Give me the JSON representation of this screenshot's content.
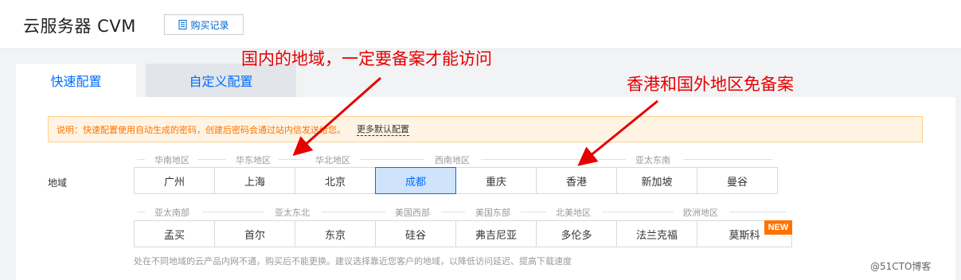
{
  "header": {
    "title": "云服务器 CVM",
    "history_button": "购买记录"
  },
  "tabs": [
    {
      "label": "快速配置",
      "active": true
    },
    {
      "label": "自定义配置",
      "active": false
    }
  ],
  "notice": {
    "text": "说明：快速配置使用自动生成的密码，创建后密码会通过站内信发送给您。",
    "more_link": "更多默认配置"
  },
  "region": {
    "label": "地域",
    "row1_groups": [
      "华南地区",
      "华东地区",
      "华北地区",
      "西南地区",
      "亚太东南"
    ],
    "row1_cells": [
      "广州",
      "上海",
      "北京",
      "成都",
      "重庆",
      "香港",
      "新加坡",
      "曼谷"
    ],
    "row2_groups": [
      "亚太南部",
      "亚太东北",
      "美国西部",
      "美国东部",
      "北美地区",
      "欧洲地区"
    ],
    "row2_cells": [
      "孟买",
      "首尔",
      "东京",
      "硅谷",
      "弗吉尼亚",
      "多伦多",
      "法兰克福",
      "莫斯科"
    ],
    "selected": "成都",
    "new_badge": "NEW",
    "hint": "处在不同地域的云产品内网不通，购买后不能更换。建议选择靠近您客户的地域，以降低访问延迟、提高下载速度"
  },
  "annotations": {
    "left": "国内的地域，一定要备案才能访问",
    "right": "香港和国外地区免备案"
  },
  "watermark": "@51CTO博客",
  "colors": {
    "accent": "#006eff",
    "annotation": "#e60000",
    "notice_bg": "#fff4e3",
    "badge": "#ff7200"
  }
}
